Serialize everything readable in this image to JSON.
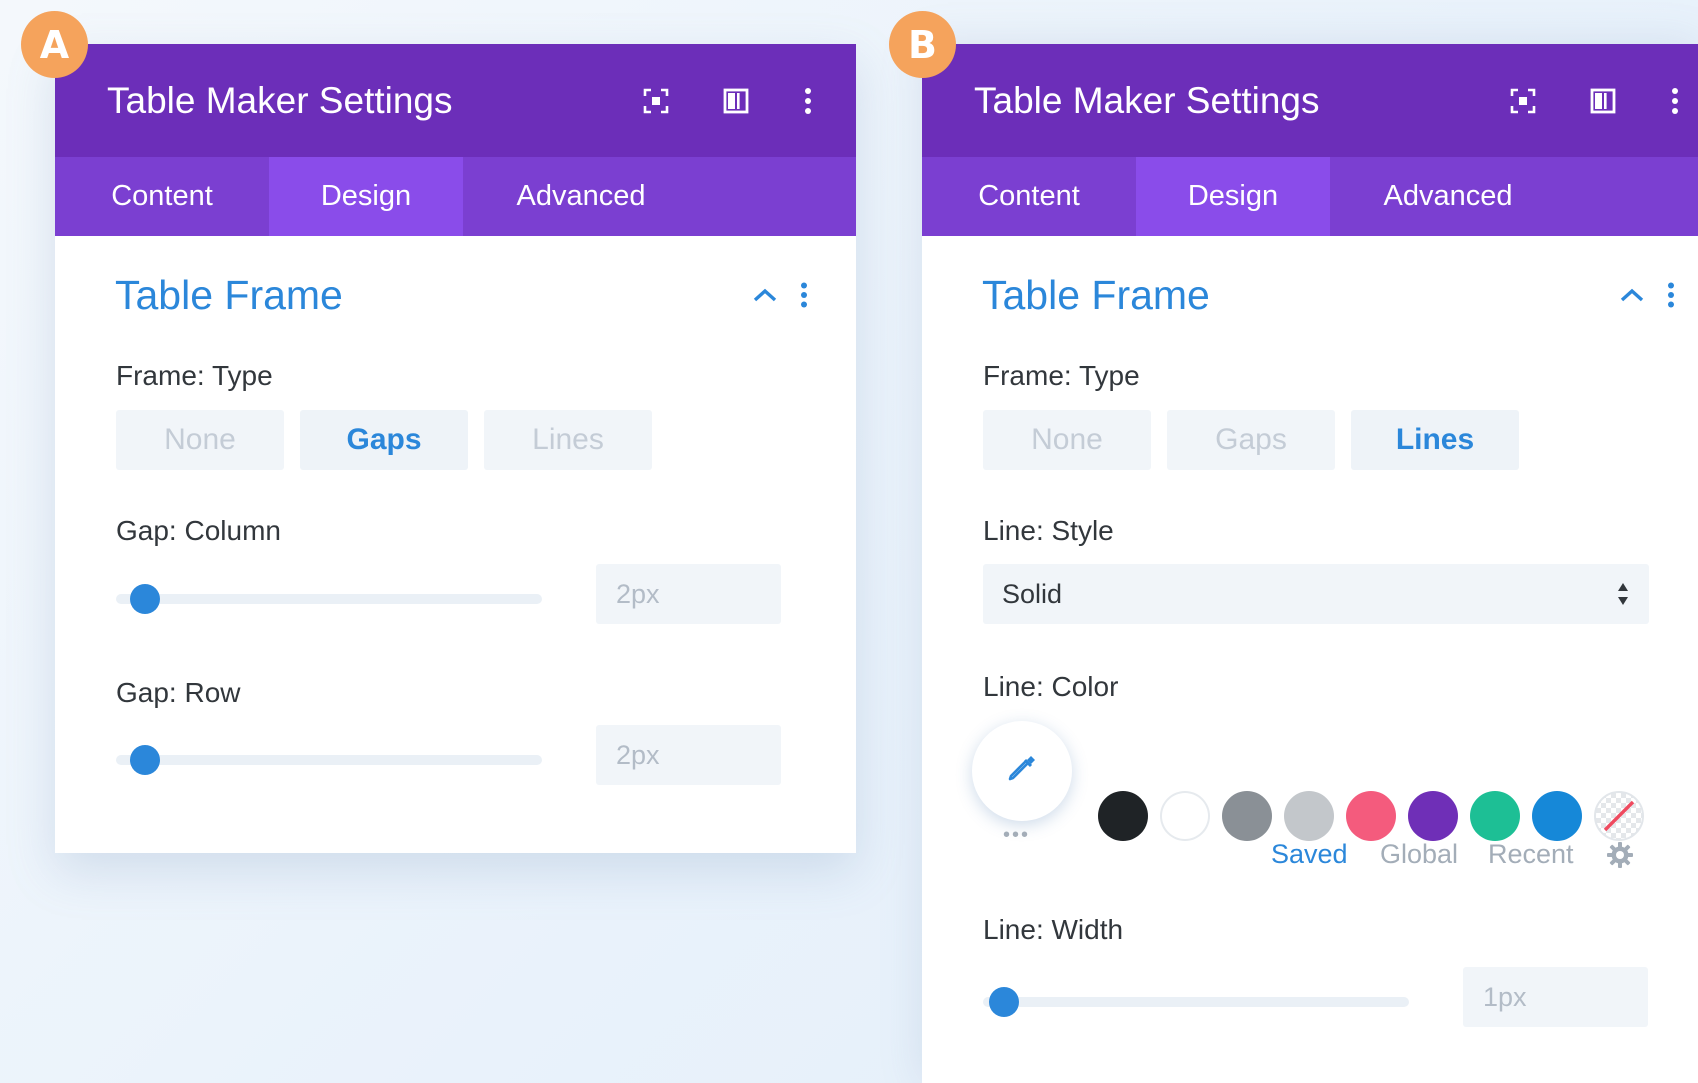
{
  "badges": {
    "a": "A",
    "b": "B"
  },
  "panelA": {
    "header": {
      "title": "Table Maker Settings",
      "icons": [
        "focus-icon",
        "sidebar-toggle-icon",
        "more-vertical-icon"
      ]
    },
    "tabs": [
      {
        "label": "Content"
      },
      {
        "label": "Design",
        "active": true
      },
      {
        "label": "Advanced"
      }
    ],
    "section": {
      "title": "Table Frame"
    },
    "frame_type": {
      "label": "Frame: Type",
      "options": [
        "None",
        "Gaps",
        "Lines"
      ],
      "selected": "Gaps"
    },
    "gap_column": {
      "label": "Gap: Column",
      "value": "2px",
      "slider_fraction": 0.02
    },
    "gap_row": {
      "label": "Gap: Row",
      "value": "2px",
      "slider_fraction": 0.02
    }
  },
  "panelB": {
    "header": {
      "title": "Table Maker Settings",
      "icons": [
        "focus-icon",
        "sidebar-toggle-icon",
        "more-vertical-icon"
      ]
    },
    "tabs": [
      {
        "label": "Content"
      },
      {
        "label": "Design",
        "active": true
      },
      {
        "label": "Advanced"
      }
    ],
    "section": {
      "title": "Table Frame"
    },
    "frame_type": {
      "label": "Frame: Type",
      "options": [
        "None",
        "Gaps",
        "Lines"
      ],
      "selected": "Lines"
    },
    "line_style": {
      "label": "Line: Style",
      "value": "Solid"
    },
    "line_color": {
      "label": "Line: Color",
      "swatches": [
        "#1f2326",
        "#ffffff",
        "#8a9096",
        "#c3c7cb",
        "#f45b7d",
        "#6f2fb7",
        "#1dbf95",
        "#1688d8",
        "none"
      ],
      "tabs": [
        "Saved",
        "Global",
        "Recent"
      ],
      "active_tab": "Saved",
      "more_dots": "•••"
    },
    "line_width": {
      "label": "Line: Width",
      "value": "1px",
      "slider_fraction": 0.01
    }
  },
  "colors": {
    "header": "#6c2eb9",
    "tabs": "#7b3fd1",
    "active_tab": "#8a4cea",
    "accent": "#2b87da",
    "badge": "#f5a35c"
  }
}
